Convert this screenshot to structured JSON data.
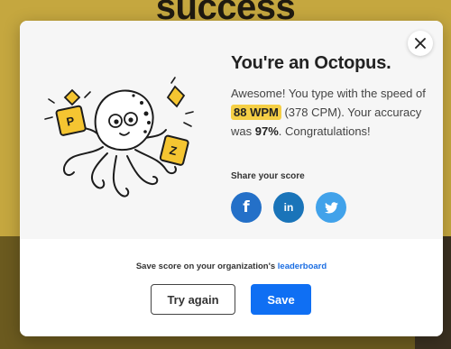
{
  "background": {
    "heading": "success"
  },
  "modal": {
    "title": "You're an Octopus.",
    "description": {
      "before_wpm": "Awesome! You type with the speed of ",
      "wpm": "88 WPM",
      "after_wpm": " (378 CPM). Your accuracy was ",
      "accuracy": "97%",
      "end": ". Congratulations!"
    },
    "illustration": {
      "icon": "octopus-illustration",
      "card_letters": [
        "P",
        "Z"
      ]
    },
    "share": {
      "label": "Share your score",
      "buttons": [
        {
          "name": "facebook",
          "glyph": "f",
          "color": "#2470c8"
        },
        {
          "name": "linkedin",
          "glyph": "in",
          "color": "#1a74b9"
        },
        {
          "name": "twitter",
          "icon": "twitter-bird-icon",
          "color": "#41a2ea"
        }
      ]
    },
    "footer": {
      "save_text": "Save score on your organization's ",
      "leaderboard_link": "leaderboard",
      "try_again": "Try again",
      "save": "Save"
    },
    "colors": {
      "accent": "#0f6ff3",
      "highlight": "#f5cf45",
      "page_background": "#c5a73f"
    }
  }
}
